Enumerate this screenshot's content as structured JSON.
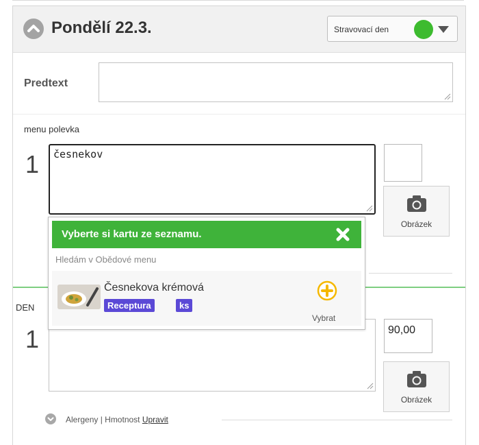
{
  "day": {
    "title": "Pondělí 22.3.",
    "day_type_label": "Stravovací den",
    "day_type_color": "#3dbb2f"
  },
  "predtext": {
    "label": "Predtext",
    "value": ""
  },
  "soup": {
    "section_label": "menu polevka",
    "number": "1",
    "text": "česnekov",
    "price": "",
    "image_button_label": "Obrázek"
  },
  "daily": {
    "section_label": "DEN",
    "number": "1",
    "text": "",
    "price": "90,00",
    "image_button_label": "Obrázek",
    "allergens_text": "Alergeny | Hmotnost",
    "edit_link": "Upravit"
  },
  "dropdown": {
    "title": "Vyberte si kartu ze seznamu.",
    "search_status": "Hledám v Obědové menu",
    "item": {
      "name": "Česnekova krémová",
      "badges": [
        "Receptura",
        "ks"
      ],
      "pick_label": "Vybrat"
    },
    "accent_color": "#3fb33a",
    "badge_color": "#5b49d6",
    "pick_icon_color": "#f5b800"
  }
}
